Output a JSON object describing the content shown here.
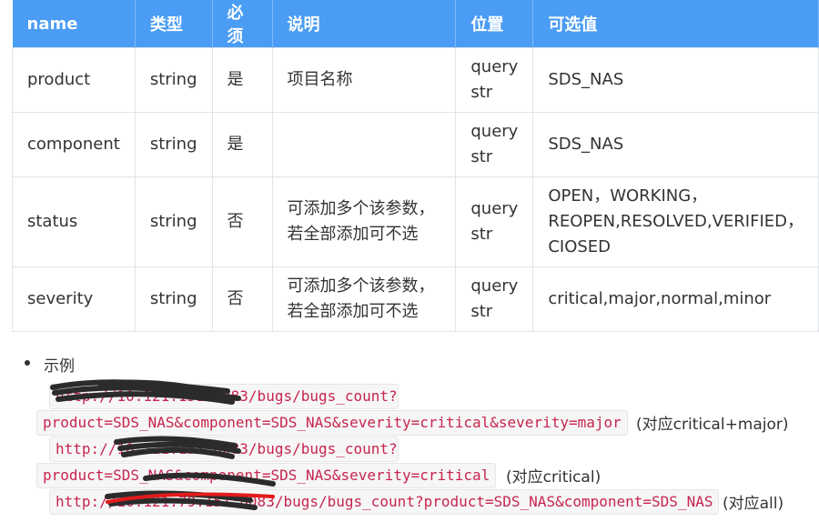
{
  "table": {
    "headers": [
      "name",
      "类型",
      "必须",
      "说明",
      "位置",
      "可选值"
    ],
    "rows": [
      {
        "name": "product",
        "type": "string",
        "required": "是",
        "desc1": "项目名称",
        "desc2": "",
        "loc1": "query",
        "loc2": "str",
        "opt1": "SDS_NAS",
        "opt2": "",
        "opt3": ""
      },
      {
        "name": "component",
        "type": "string",
        "required": "是",
        "desc1": "",
        "desc2": "",
        "loc1": "query",
        "loc2": "str",
        "opt1": "SDS_NAS",
        "opt2": "",
        "opt3": ""
      },
      {
        "name": "status",
        "type": "string",
        "required": "否",
        "desc1": "可添加多个该参数，",
        "desc2": "若全部添加可不选",
        "loc1": "query",
        "loc2": "str",
        "opt1": "OPEN，WORKING，",
        "opt2": "REOPEN,RESOLVED,VERIFIED，",
        "opt3": "CIOSED"
      },
      {
        "name": "severity",
        "type": "string",
        "required": "否",
        "desc1": "可添加多个该参数，",
        "desc2": "若全部添加可不选",
        "loc1": "query",
        "loc2": "str",
        "opt1": "critical,major,normal,minor",
        "opt2": "",
        "opt3": ""
      }
    ]
  },
  "example": {
    "label": "示例",
    "url1_line1": "http://10.121.151:8083/bugs/bugs_count?",
    "url1_line2": "product=SDS_NAS&component=SDS_NAS&severity=critical&severity=major",
    "note1": "(对应critical+major)",
    "url2_line1": "http://10.121.151:8083/bugs/bugs_count?",
    "url2_line2": "product=SDS_NAS&component=SDS_NAS&severity=critical",
    "note2": "(对应critical)",
    "url3": "http://10.121.79.151:8083/bugs/bugs_count?product=SDS_NAS&component=SDS_NAS",
    "note3": "(对应all)"
  },
  "colors": {
    "header_bg": "#4a9cf4",
    "code_text": "#c7254e",
    "code_bg": "#f6f6f6",
    "redaction": "#2b2b2b",
    "red_strike": "#e21b1b"
  }
}
